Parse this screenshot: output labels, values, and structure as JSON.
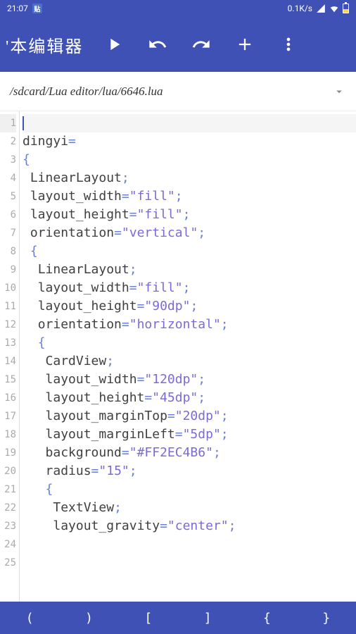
{
  "status": {
    "time": "21:07",
    "tieba": "贴",
    "speed": "0.1K/s"
  },
  "toolbar": {
    "title": "'本编辑器"
  },
  "path": {
    "value": "/sdcard/Lua editor/lua/6646.lua"
  },
  "code": {
    "lines": [
      {
        "num": 1,
        "indent": 0,
        "tokens": [],
        "current": true
      },
      {
        "num": 2,
        "indent": 0,
        "tokens": []
      },
      {
        "num": 3,
        "indent": 0,
        "tokens": []
      },
      {
        "num": 4,
        "indent": 0,
        "tokens": [
          {
            "t": "dingyi",
            "c": "plain"
          },
          {
            "t": "=",
            "c": "sym"
          }
        ]
      },
      {
        "num": 5,
        "indent": 0,
        "tokens": [
          {
            "t": "{",
            "c": "sym"
          }
        ]
      },
      {
        "num": 6,
        "indent": 1,
        "tokens": [
          {
            "t": "LinearLayout",
            "c": "plain"
          },
          {
            "t": ";",
            "c": "sym"
          }
        ]
      },
      {
        "num": 7,
        "indent": 1,
        "tokens": [
          {
            "t": "layout_width",
            "c": "plain"
          },
          {
            "t": "=",
            "c": "sym"
          },
          {
            "t": "\"fill\"",
            "c": "str"
          },
          {
            "t": ";",
            "c": "sym"
          }
        ]
      },
      {
        "num": 8,
        "indent": 1,
        "tokens": [
          {
            "t": "layout_height",
            "c": "plain"
          },
          {
            "t": "=",
            "c": "sym"
          },
          {
            "t": "\"fill\"",
            "c": "str"
          },
          {
            "t": ";",
            "c": "sym"
          }
        ]
      },
      {
        "num": 9,
        "indent": 1,
        "tokens": [
          {
            "t": "orientation",
            "c": "plain"
          },
          {
            "t": "=",
            "c": "sym"
          },
          {
            "t": "\"vertical\"",
            "c": "str"
          },
          {
            "t": ";",
            "c": "sym"
          }
        ]
      },
      {
        "num": 10,
        "indent": 1,
        "tokens": [
          {
            "t": "{",
            "c": "sym"
          }
        ]
      },
      {
        "num": 11,
        "indent": 2,
        "tokens": [
          {
            "t": "LinearLayout",
            "c": "plain"
          },
          {
            "t": ";",
            "c": "sym"
          }
        ]
      },
      {
        "num": 12,
        "indent": 2,
        "tokens": [
          {
            "t": "layout_width",
            "c": "plain"
          },
          {
            "t": "=",
            "c": "sym"
          },
          {
            "t": "\"fill\"",
            "c": "str"
          },
          {
            "t": ";",
            "c": "sym"
          }
        ]
      },
      {
        "num": 13,
        "indent": 2,
        "tokens": [
          {
            "t": "layout_height",
            "c": "plain"
          },
          {
            "t": "=",
            "c": "sym"
          },
          {
            "t": "\"90dp\"",
            "c": "str"
          },
          {
            "t": ";",
            "c": "sym"
          }
        ]
      },
      {
        "num": 14,
        "indent": 2,
        "tokens": [
          {
            "t": "orientation",
            "c": "plain"
          },
          {
            "t": "=",
            "c": "sym"
          },
          {
            "t": "\"horizontal\"",
            "c": "str"
          },
          {
            "t": ";",
            "c": "sym"
          }
        ]
      },
      {
        "num": 15,
        "indent": 2,
        "tokens": [
          {
            "t": "{",
            "c": "sym"
          }
        ]
      },
      {
        "num": 16,
        "indent": 3,
        "tokens": [
          {
            "t": "CardView",
            "c": "plain"
          },
          {
            "t": ";",
            "c": "sym"
          }
        ]
      },
      {
        "num": 17,
        "indent": 3,
        "tokens": [
          {
            "t": "layout_width",
            "c": "plain"
          },
          {
            "t": "=",
            "c": "sym"
          },
          {
            "t": "\"120dp\"",
            "c": "str"
          },
          {
            "t": ";",
            "c": "sym"
          }
        ]
      },
      {
        "num": 18,
        "indent": 3,
        "tokens": [
          {
            "t": "layout_height",
            "c": "plain"
          },
          {
            "t": "=",
            "c": "sym"
          },
          {
            "t": "\"45dp\"",
            "c": "str"
          },
          {
            "t": ";",
            "c": "sym"
          }
        ]
      },
      {
        "num": 19,
        "indent": 3,
        "tokens": [
          {
            "t": "layout_marginTop",
            "c": "plain"
          },
          {
            "t": "=",
            "c": "sym"
          },
          {
            "t": "\"20dp\"",
            "c": "str"
          },
          {
            "t": ";",
            "c": "sym"
          }
        ]
      },
      {
        "num": 20,
        "indent": 3,
        "tokens": [
          {
            "t": "layout_marginLeft",
            "c": "plain"
          },
          {
            "t": "=",
            "c": "sym"
          },
          {
            "t": "\"5dp\"",
            "c": "str"
          },
          {
            "t": ";",
            "c": "sym"
          }
        ]
      },
      {
        "num": 21,
        "indent": 3,
        "tokens": [
          {
            "t": "background",
            "c": "plain"
          },
          {
            "t": "=",
            "c": "sym"
          },
          {
            "t": "\"#FF2EC4B6\"",
            "c": "str"
          },
          {
            "t": ";",
            "c": "sym"
          }
        ]
      },
      {
        "num": 22,
        "indent": 3,
        "tokens": [
          {
            "t": "radius",
            "c": "plain"
          },
          {
            "t": "=",
            "c": "sym"
          },
          {
            "t": "\"15\"",
            "c": "str"
          },
          {
            "t": ";",
            "c": "sym"
          }
        ]
      },
      {
        "num": 23,
        "indent": 3,
        "tokens": [
          {
            "t": "{",
            "c": "sym"
          }
        ]
      },
      {
        "num": 24,
        "indent": 4,
        "tokens": [
          {
            "t": "TextView",
            "c": "plain"
          },
          {
            "t": ";",
            "c": "sym"
          }
        ]
      },
      {
        "num": 25,
        "indent": 4,
        "tokens": [
          {
            "t": "layout_gravity",
            "c": "plain"
          },
          {
            "t": "=",
            "c": "sym"
          },
          {
            "t": "\"center\"",
            "c": "str"
          },
          {
            "t": ";",
            "c": "sym"
          }
        ]
      }
    ]
  },
  "bottomKeys": [
    "(",
    ")",
    "[",
    "]",
    "{",
    "}"
  ]
}
